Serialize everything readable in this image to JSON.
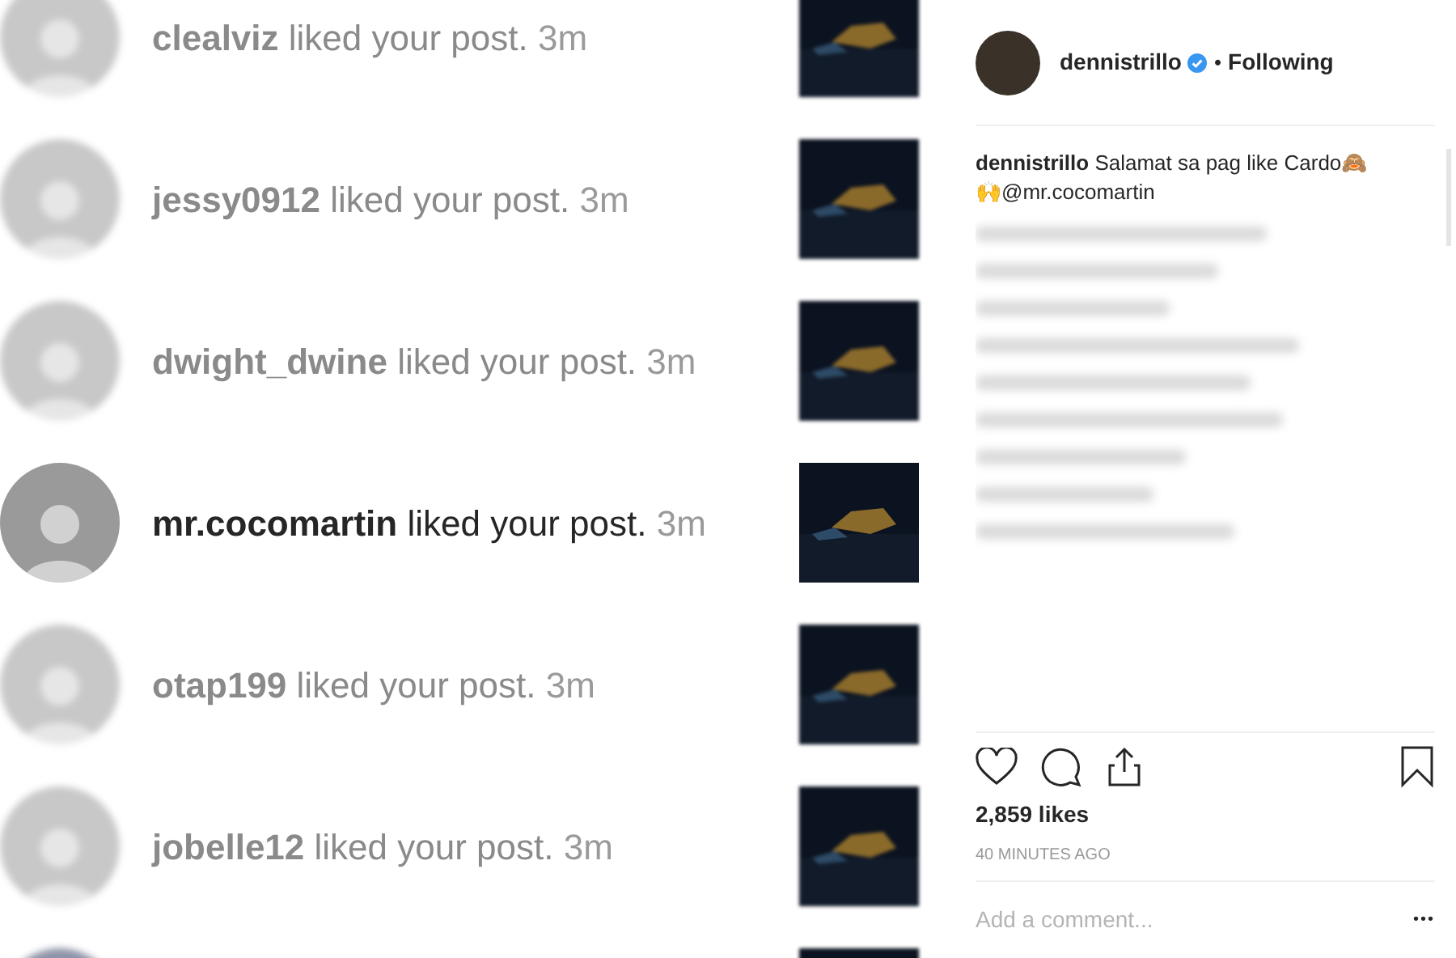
{
  "notifications": [
    {
      "username": "clealviz",
      "action": "liked your post.",
      "time": "3m",
      "blurred": true
    },
    {
      "username": "jessy0912",
      "action": "liked your post.",
      "time": "3m",
      "blurred": true
    },
    {
      "username": "dwight_dwine",
      "action": "liked your post.",
      "time": "3m",
      "blurred": true
    },
    {
      "username": "mr.cocomartin",
      "action": "liked your post.",
      "time": "3m",
      "blurred": false
    },
    {
      "username": "otap199",
      "action": "liked your post.",
      "time": "3m",
      "blurred": true
    },
    {
      "username": "jobelle12",
      "action": "liked your post.",
      "time": "3m",
      "blurred": true
    }
  ],
  "post": {
    "author": "dennistrillo",
    "verified": true,
    "separator": "•",
    "follow_state": "Following",
    "caption_author": "dennistrillo",
    "caption": "Salamat sa pag like Cardo🙈",
    "caption_line2": "🙌@mr.cocomartin",
    "likes": "2,859 likes",
    "time": "40 MINUTES AGO",
    "comment_placeholder": "Add a comment...",
    "more": "•••"
  }
}
